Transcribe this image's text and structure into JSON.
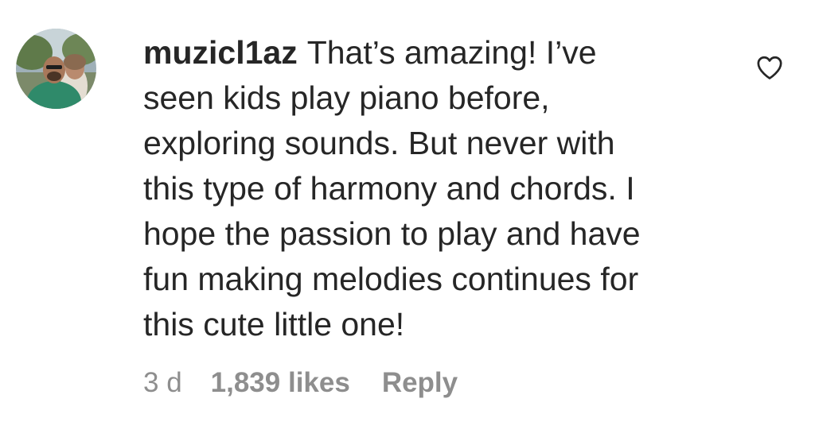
{
  "comment": {
    "username": "muzicl1az",
    "text": "That’s amazing! I’ve\nseen kids play piano before,\nexploring sounds. But never with\nthis type of harmony and chords. I\nhope the passion to play and have\nfun making melodies continues for\nthis cute little one!",
    "time": "3 d",
    "likes": "1,839 likes",
    "reply_label": "Reply"
  },
  "icons": {
    "like": "heart-outline-icon",
    "avatar": "user-avatar-photo"
  },
  "colors": {
    "text": "#262626",
    "secondary": "#8e8e8e",
    "background": "#ffffff"
  }
}
